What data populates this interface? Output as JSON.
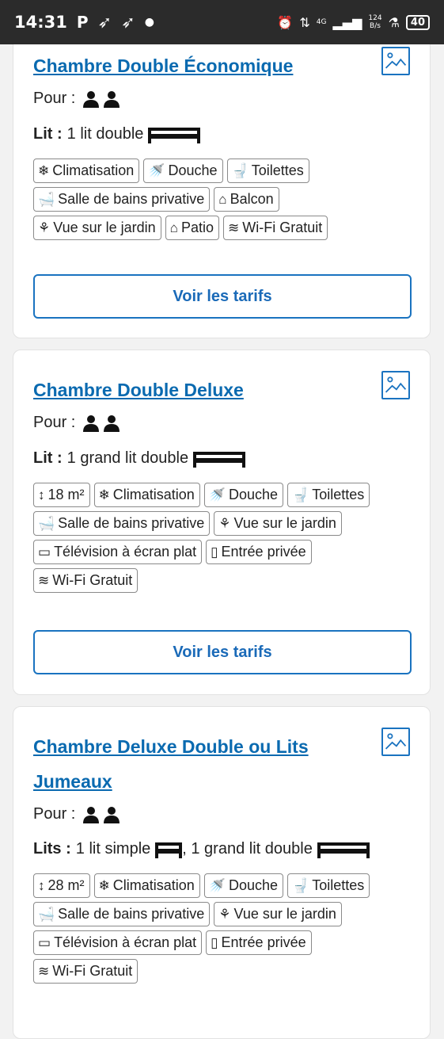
{
  "status_bar": {
    "time": "14:31",
    "app_letter": "P",
    "network": "4G",
    "speed_value": "124",
    "speed_unit": "B/s",
    "battery": "40"
  },
  "labels": {
    "pour": "Pour :",
    "voir_tarifs": "Voir les tarifs"
  },
  "rooms": [
    {
      "title": "Chambre Double Économique",
      "bed_label": "Lit :",
      "bed_text": "1 lit double",
      "tags": [
        {
          "icon": "snowflake-icon",
          "label": "Climatisation"
        },
        {
          "icon": "shower-icon",
          "label": "Douche"
        },
        {
          "icon": "toilet-icon",
          "label": "Toilettes"
        },
        {
          "icon": "bath-icon",
          "label": "Salle de bains privative"
        },
        {
          "icon": "balcony-icon",
          "label": "Balcon"
        },
        {
          "icon": "flower-icon",
          "label": "Vue sur le jardin"
        },
        {
          "icon": "patio-icon",
          "label": "Patio"
        },
        {
          "icon": "wifi-icon",
          "label": "Wi-Fi Gratuit"
        }
      ]
    },
    {
      "title": "Chambre Double Deluxe",
      "bed_label": "Lit :",
      "bed_text": "1 grand lit double",
      "tags": [
        {
          "icon": "size-icon",
          "label": "18 m²"
        },
        {
          "icon": "snowflake-icon",
          "label": "Climatisation"
        },
        {
          "icon": "shower-icon",
          "label": "Douche"
        },
        {
          "icon": "toilet-icon",
          "label": "Toilettes"
        },
        {
          "icon": "bath-icon",
          "label": "Salle de bains privative"
        },
        {
          "icon": "flower-icon",
          "label": "Vue sur le jardin"
        },
        {
          "icon": "tv-icon",
          "label": "Télévision à écran plat"
        },
        {
          "icon": "door-icon",
          "label": "Entrée privée"
        },
        {
          "icon": "wifi-icon",
          "label": "Wi-Fi Gratuit"
        }
      ]
    },
    {
      "title_line1": "Chambre Deluxe Double ou Lits",
      "title_line2": "Jumeaux",
      "bed_label": "Lits :",
      "bed_text_1": "1 lit simple",
      "bed_text_2": ", 1 grand lit double",
      "tags": [
        {
          "icon": "size-icon",
          "label": "28 m²"
        },
        {
          "icon": "snowflake-icon",
          "label": "Climatisation"
        },
        {
          "icon": "shower-icon",
          "label": "Douche"
        },
        {
          "icon": "toilet-icon",
          "label": "Toilettes"
        },
        {
          "icon": "bath-icon",
          "label": "Salle de bains privative"
        },
        {
          "icon": "flower-icon",
          "label": "Vue sur le jardin"
        },
        {
          "icon": "tv-icon",
          "label": "Télévision à écran plat"
        },
        {
          "icon": "door-icon",
          "label": "Entrée privée"
        },
        {
          "icon": "wifi-icon",
          "label": "Wi-Fi Gratuit"
        }
      ]
    }
  ]
}
